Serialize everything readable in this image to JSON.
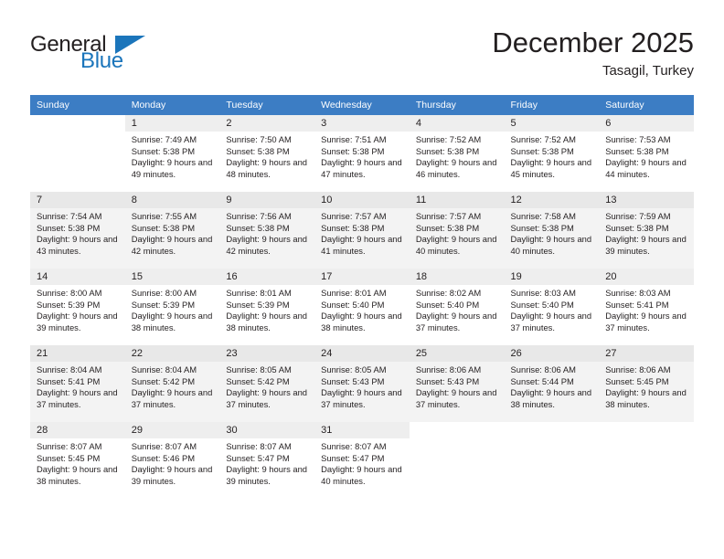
{
  "logo": {
    "primary_text": "General",
    "secondary_text": "Blue",
    "triangle_icon": "triangle-icon",
    "primary_color": "#231f20",
    "accent_color": "#1b75bb"
  },
  "header": {
    "title": "December 2025",
    "subtitle": "Tasagil, Turkey"
  },
  "colors": {
    "header_row_bg": "#3c7dc4",
    "header_row_text": "#ffffff",
    "alt_row_bg": "#f3f3f3",
    "daynum_bg": "#eeeeee",
    "body_text": "#231f20"
  },
  "weekdays": [
    "Sunday",
    "Monday",
    "Tuesday",
    "Wednesday",
    "Thursday",
    "Friday",
    "Saturday"
  ],
  "labels": {
    "sunrise_prefix": "Sunrise:",
    "sunset_prefix": "Sunset:",
    "daylight_prefix": "Daylight:"
  },
  "weeks": [
    {
      "shaded": false,
      "days": [
        {
          "day": "",
          "sunrise": "",
          "sunset": "",
          "daylight": "",
          "empty": true
        },
        {
          "day": "1",
          "sunrise": "Sunrise: 7:49 AM",
          "sunset": "Sunset: 5:38 PM",
          "daylight": "Daylight: 9 hours and 49 minutes.",
          "empty": false
        },
        {
          "day": "2",
          "sunrise": "Sunrise: 7:50 AM",
          "sunset": "Sunset: 5:38 PM",
          "daylight": "Daylight: 9 hours and 48 minutes.",
          "empty": false
        },
        {
          "day": "3",
          "sunrise": "Sunrise: 7:51 AM",
          "sunset": "Sunset: 5:38 PM",
          "daylight": "Daylight: 9 hours and 47 minutes.",
          "empty": false
        },
        {
          "day": "4",
          "sunrise": "Sunrise: 7:52 AM",
          "sunset": "Sunset: 5:38 PM",
          "daylight": "Daylight: 9 hours and 46 minutes.",
          "empty": false
        },
        {
          "day": "5",
          "sunrise": "Sunrise: 7:52 AM",
          "sunset": "Sunset: 5:38 PM",
          "daylight": "Daylight: 9 hours and 45 minutes.",
          "empty": false
        },
        {
          "day": "6",
          "sunrise": "Sunrise: 7:53 AM",
          "sunset": "Sunset: 5:38 PM",
          "daylight": "Daylight: 9 hours and 44 minutes.",
          "empty": false
        }
      ]
    },
    {
      "shaded": true,
      "days": [
        {
          "day": "7",
          "sunrise": "Sunrise: 7:54 AM",
          "sunset": "Sunset: 5:38 PM",
          "daylight": "Daylight: 9 hours and 43 minutes.",
          "empty": false
        },
        {
          "day": "8",
          "sunrise": "Sunrise: 7:55 AM",
          "sunset": "Sunset: 5:38 PM",
          "daylight": "Daylight: 9 hours and 42 minutes.",
          "empty": false
        },
        {
          "day": "9",
          "sunrise": "Sunrise: 7:56 AM",
          "sunset": "Sunset: 5:38 PM",
          "daylight": "Daylight: 9 hours and 42 minutes.",
          "empty": false
        },
        {
          "day": "10",
          "sunrise": "Sunrise: 7:57 AM",
          "sunset": "Sunset: 5:38 PM",
          "daylight": "Daylight: 9 hours and 41 minutes.",
          "empty": false
        },
        {
          "day": "11",
          "sunrise": "Sunrise: 7:57 AM",
          "sunset": "Sunset: 5:38 PM",
          "daylight": "Daylight: 9 hours and 40 minutes.",
          "empty": false
        },
        {
          "day": "12",
          "sunrise": "Sunrise: 7:58 AM",
          "sunset": "Sunset: 5:38 PM",
          "daylight": "Daylight: 9 hours and 40 minutes.",
          "empty": false
        },
        {
          "day": "13",
          "sunrise": "Sunrise: 7:59 AM",
          "sunset": "Sunset: 5:38 PM",
          "daylight": "Daylight: 9 hours and 39 minutes.",
          "empty": false
        }
      ]
    },
    {
      "shaded": false,
      "days": [
        {
          "day": "14",
          "sunrise": "Sunrise: 8:00 AM",
          "sunset": "Sunset: 5:39 PM",
          "daylight": "Daylight: 9 hours and 39 minutes.",
          "empty": false
        },
        {
          "day": "15",
          "sunrise": "Sunrise: 8:00 AM",
          "sunset": "Sunset: 5:39 PM",
          "daylight": "Daylight: 9 hours and 38 minutes.",
          "empty": false
        },
        {
          "day": "16",
          "sunrise": "Sunrise: 8:01 AM",
          "sunset": "Sunset: 5:39 PM",
          "daylight": "Daylight: 9 hours and 38 minutes.",
          "empty": false
        },
        {
          "day": "17",
          "sunrise": "Sunrise: 8:01 AM",
          "sunset": "Sunset: 5:40 PM",
          "daylight": "Daylight: 9 hours and 38 minutes.",
          "empty": false
        },
        {
          "day": "18",
          "sunrise": "Sunrise: 8:02 AM",
          "sunset": "Sunset: 5:40 PM",
          "daylight": "Daylight: 9 hours and 37 minutes.",
          "empty": false
        },
        {
          "day": "19",
          "sunrise": "Sunrise: 8:03 AM",
          "sunset": "Sunset: 5:40 PM",
          "daylight": "Daylight: 9 hours and 37 minutes.",
          "empty": false
        },
        {
          "day": "20",
          "sunrise": "Sunrise: 8:03 AM",
          "sunset": "Sunset: 5:41 PM",
          "daylight": "Daylight: 9 hours and 37 minutes.",
          "empty": false
        }
      ]
    },
    {
      "shaded": true,
      "days": [
        {
          "day": "21",
          "sunrise": "Sunrise: 8:04 AM",
          "sunset": "Sunset: 5:41 PM",
          "daylight": "Daylight: 9 hours and 37 minutes.",
          "empty": false
        },
        {
          "day": "22",
          "sunrise": "Sunrise: 8:04 AM",
          "sunset": "Sunset: 5:42 PM",
          "daylight": "Daylight: 9 hours and 37 minutes.",
          "empty": false
        },
        {
          "day": "23",
          "sunrise": "Sunrise: 8:05 AM",
          "sunset": "Sunset: 5:42 PM",
          "daylight": "Daylight: 9 hours and 37 minutes.",
          "empty": false
        },
        {
          "day": "24",
          "sunrise": "Sunrise: 8:05 AM",
          "sunset": "Sunset: 5:43 PM",
          "daylight": "Daylight: 9 hours and 37 minutes.",
          "empty": false
        },
        {
          "day": "25",
          "sunrise": "Sunrise: 8:06 AM",
          "sunset": "Sunset: 5:43 PM",
          "daylight": "Daylight: 9 hours and 37 minutes.",
          "empty": false
        },
        {
          "day": "26",
          "sunrise": "Sunrise: 8:06 AM",
          "sunset": "Sunset: 5:44 PM",
          "daylight": "Daylight: 9 hours and 38 minutes.",
          "empty": false
        },
        {
          "day": "27",
          "sunrise": "Sunrise: 8:06 AM",
          "sunset": "Sunset: 5:45 PM",
          "daylight": "Daylight: 9 hours and 38 minutes.",
          "empty": false
        }
      ]
    },
    {
      "shaded": false,
      "days": [
        {
          "day": "28",
          "sunrise": "Sunrise: 8:07 AM",
          "sunset": "Sunset: 5:45 PM",
          "daylight": "Daylight: 9 hours and 38 minutes.",
          "empty": false
        },
        {
          "day": "29",
          "sunrise": "Sunrise: 8:07 AM",
          "sunset": "Sunset: 5:46 PM",
          "daylight": "Daylight: 9 hours and 39 minutes.",
          "empty": false
        },
        {
          "day": "30",
          "sunrise": "Sunrise: 8:07 AM",
          "sunset": "Sunset: 5:47 PM",
          "daylight": "Daylight: 9 hours and 39 minutes.",
          "empty": false
        },
        {
          "day": "31",
          "sunrise": "Sunrise: 8:07 AM",
          "sunset": "Sunset: 5:47 PM",
          "daylight": "Daylight: 9 hours and 40 minutes.",
          "empty": false
        },
        {
          "day": "",
          "sunrise": "",
          "sunset": "",
          "daylight": "",
          "empty": true
        },
        {
          "day": "",
          "sunrise": "",
          "sunset": "",
          "daylight": "",
          "empty": true
        },
        {
          "day": "",
          "sunrise": "",
          "sunset": "",
          "daylight": "",
          "empty": true
        }
      ]
    }
  ]
}
